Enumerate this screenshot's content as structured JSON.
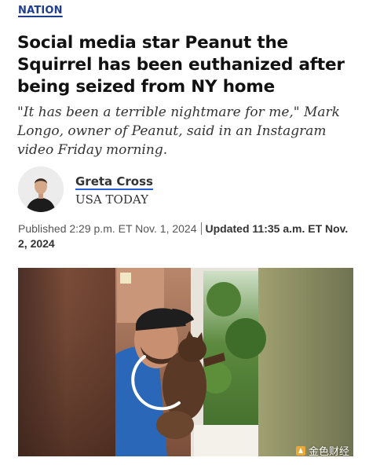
{
  "section": {
    "label": "NATION"
  },
  "article": {
    "headline": "Social media star Peanut the Squirrel has been euthanized after being seized from NY home",
    "dek": "\"It has been a terrible nightmare for me,\" Mark Longo, owner of Peanut, said in an Instagram video Friday morning."
  },
  "byline": {
    "author": "Greta Cross",
    "org": "USA TODAY"
  },
  "dates": {
    "published": "Published 2:29 p.m. ET Nov. 1, 2024",
    "updated": "Updated 11:35 a.m. ET Nov. 2, 2024"
  },
  "photo": {
    "icon": "loading-spinner-icon"
  },
  "watermark": {
    "text": "金色财经"
  },
  "colors": {
    "section": "#1f3c8f",
    "link_underline": "#2c5bd6"
  }
}
